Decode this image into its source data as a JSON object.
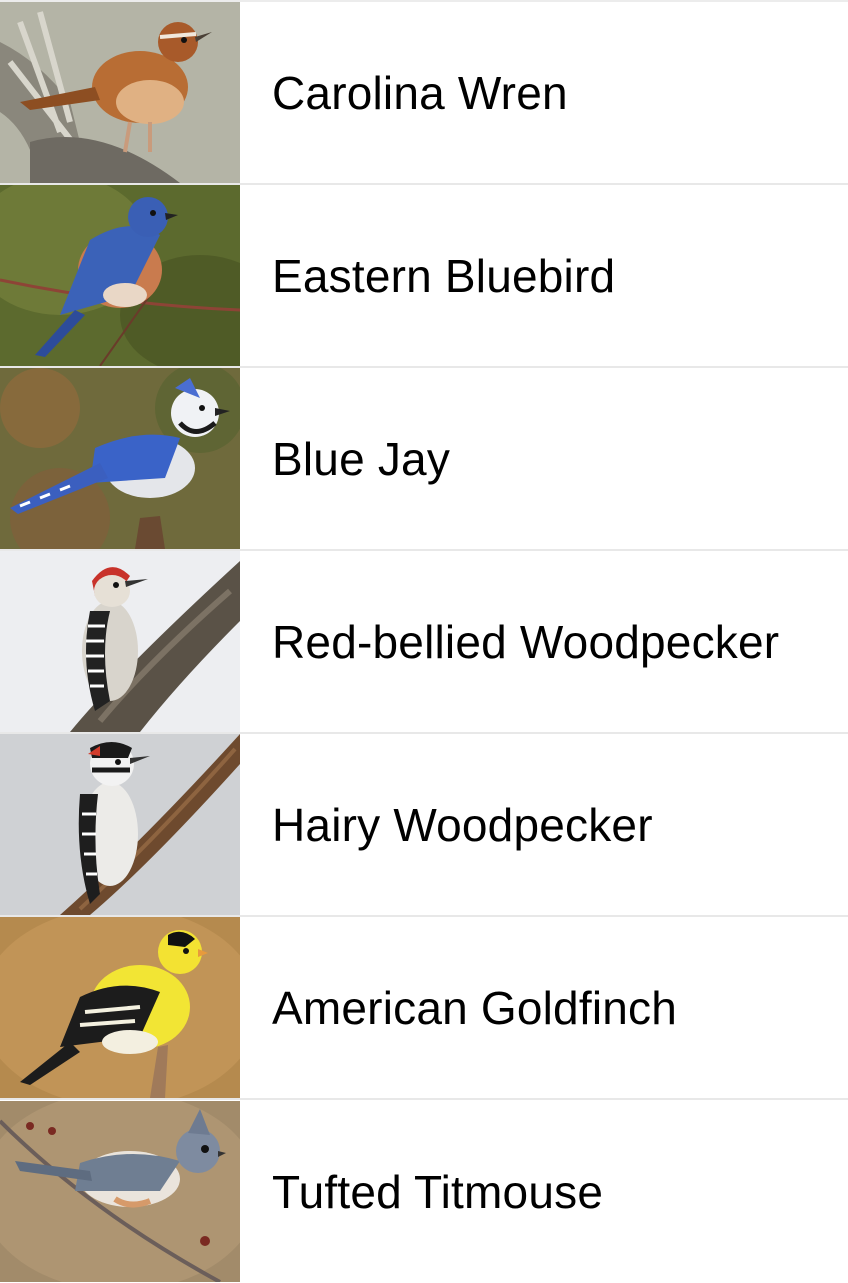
{
  "birds": [
    {
      "name": "Carolina Wren",
      "image": "carolina-wren-photo"
    },
    {
      "name": "Eastern Bluebird",
      "image": "eastern-bluebird-photo"
    },
    {
      "name": "Blue Jay",
      "image": "blue-jay-photo"
    },
    {
      "name": "Red-bellied Woodpecker",
      "image": "red-bellied-woodpecker-photo"
    },
    {
      "name": "Hairy Woodpecker",
      "image": "hairy-woodpecker-photo"
    },
    {
      "name": "American Goldfinch",
      "image": "american-goldfinch-photo"
    },
    {
      "name": "Tufted Titmouse",
      "image": "tufted-titmouse-photo"
    }
  ]
}
